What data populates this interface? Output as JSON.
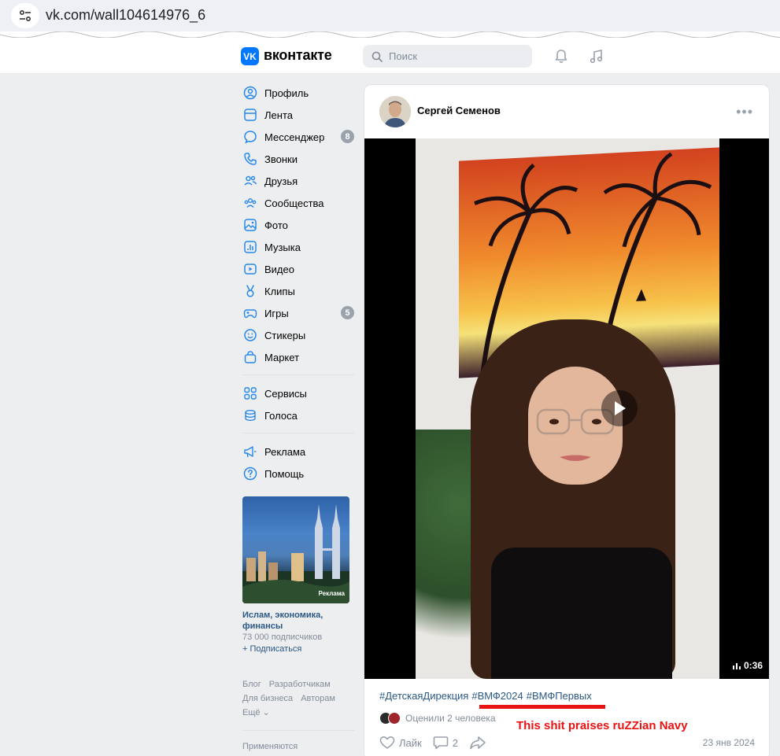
{
  "browser": {
    "url": "vk.com/wall104614976_6"
  },
  "header": {
    "logo_letters": "VK",
    "brand": "вконтакте",
    "search_placeholder": "Поиск",
    "icons": [
      "bell-icon",
      "music-icon"
    ]
  },
  "nav": {
    "items": [
      {
        "label": "Профиль",
        "icon": "profile-icon"
      },
      {
        "label": "Лента",
        "icon": "feed-icon"
      },
      {
        "label": "Мессенджер",
        "icon": "messenger-icon",
        "count": "8"
      },
      {
        "label": "Звонки",
        "icon": "phone-icon"
      },
      {
        "label": "Друзья",
        "icon": "friends-icon"
      },
      {
        "label": "Сообщества",
        "icon": "communities-icon"
      },
      {
        "label": "Фото",
        "icon": "photo-icon"
      },
      {
        "label": "Музыка",
        "icon": "music-icon"
      },
      {
        "label": "Видео",
        "icon": "video-icon"
      },
      {
        "label": "Клипы",
        "icon": "clips-icon"
      },
      {
        "label": "Игры",
        "icon": "games-icon",
        "count": "5"
      },
      {
        "label": "Стикеры",
        "icon": "stickers-icon"
      },
      {
        "label": "Маркет",
        "icon": "market-icon"
      }
    ],
    "items2": [
      {
        "label": "Сервисы",
        "icon": "services-icon"
      },
      {
        "label": "Голоса",
        "icon": "votes-icon"
      }
    ],
    "items3": [
      {
        "label": "Реклама",
        "icon": "ads-icon"
      },
      {
        "label": "Помощь",
        "icon": "help-icon"
      }
    ]
  },
  "ad": {
    "tag": "Реклама",
    "title": "Ислам, экономика, финансы",
    "subscribers": "73 000 подписчиков",
    "subscribe": "+ Подписаться"
  },
  "footer": {
    "links": [
      "Блог",
      "Разработчикам",
      "Для бизнеса",
      "Авторам",
      "Ещё ⌄"
    ],
    "applied": "Применяются"
  },
  "post": {
    "author": "Сергей Семенов",
    "more": "•••",
    "duration": "0:36",
    "tags": [
      "#ДетскаяДирекция",
      "#ВМФ2024",
      "#ВМФПервых"
    ],
    "rated_by": "Оценили 2 человека",
    "annotation": "This shit praises ruZZian Navy",
    "like_label": "Лайк",
    "comments_count": "2",
    "date": "23 янв 2024"
  },
  "colors": {
    "vk_blue": "#0077ff",
    "link": "#2a5885",
    "annotation_red": "#e81313",
    "muted": "#818c99",
    "bg": "#edeef0"
  }
}
